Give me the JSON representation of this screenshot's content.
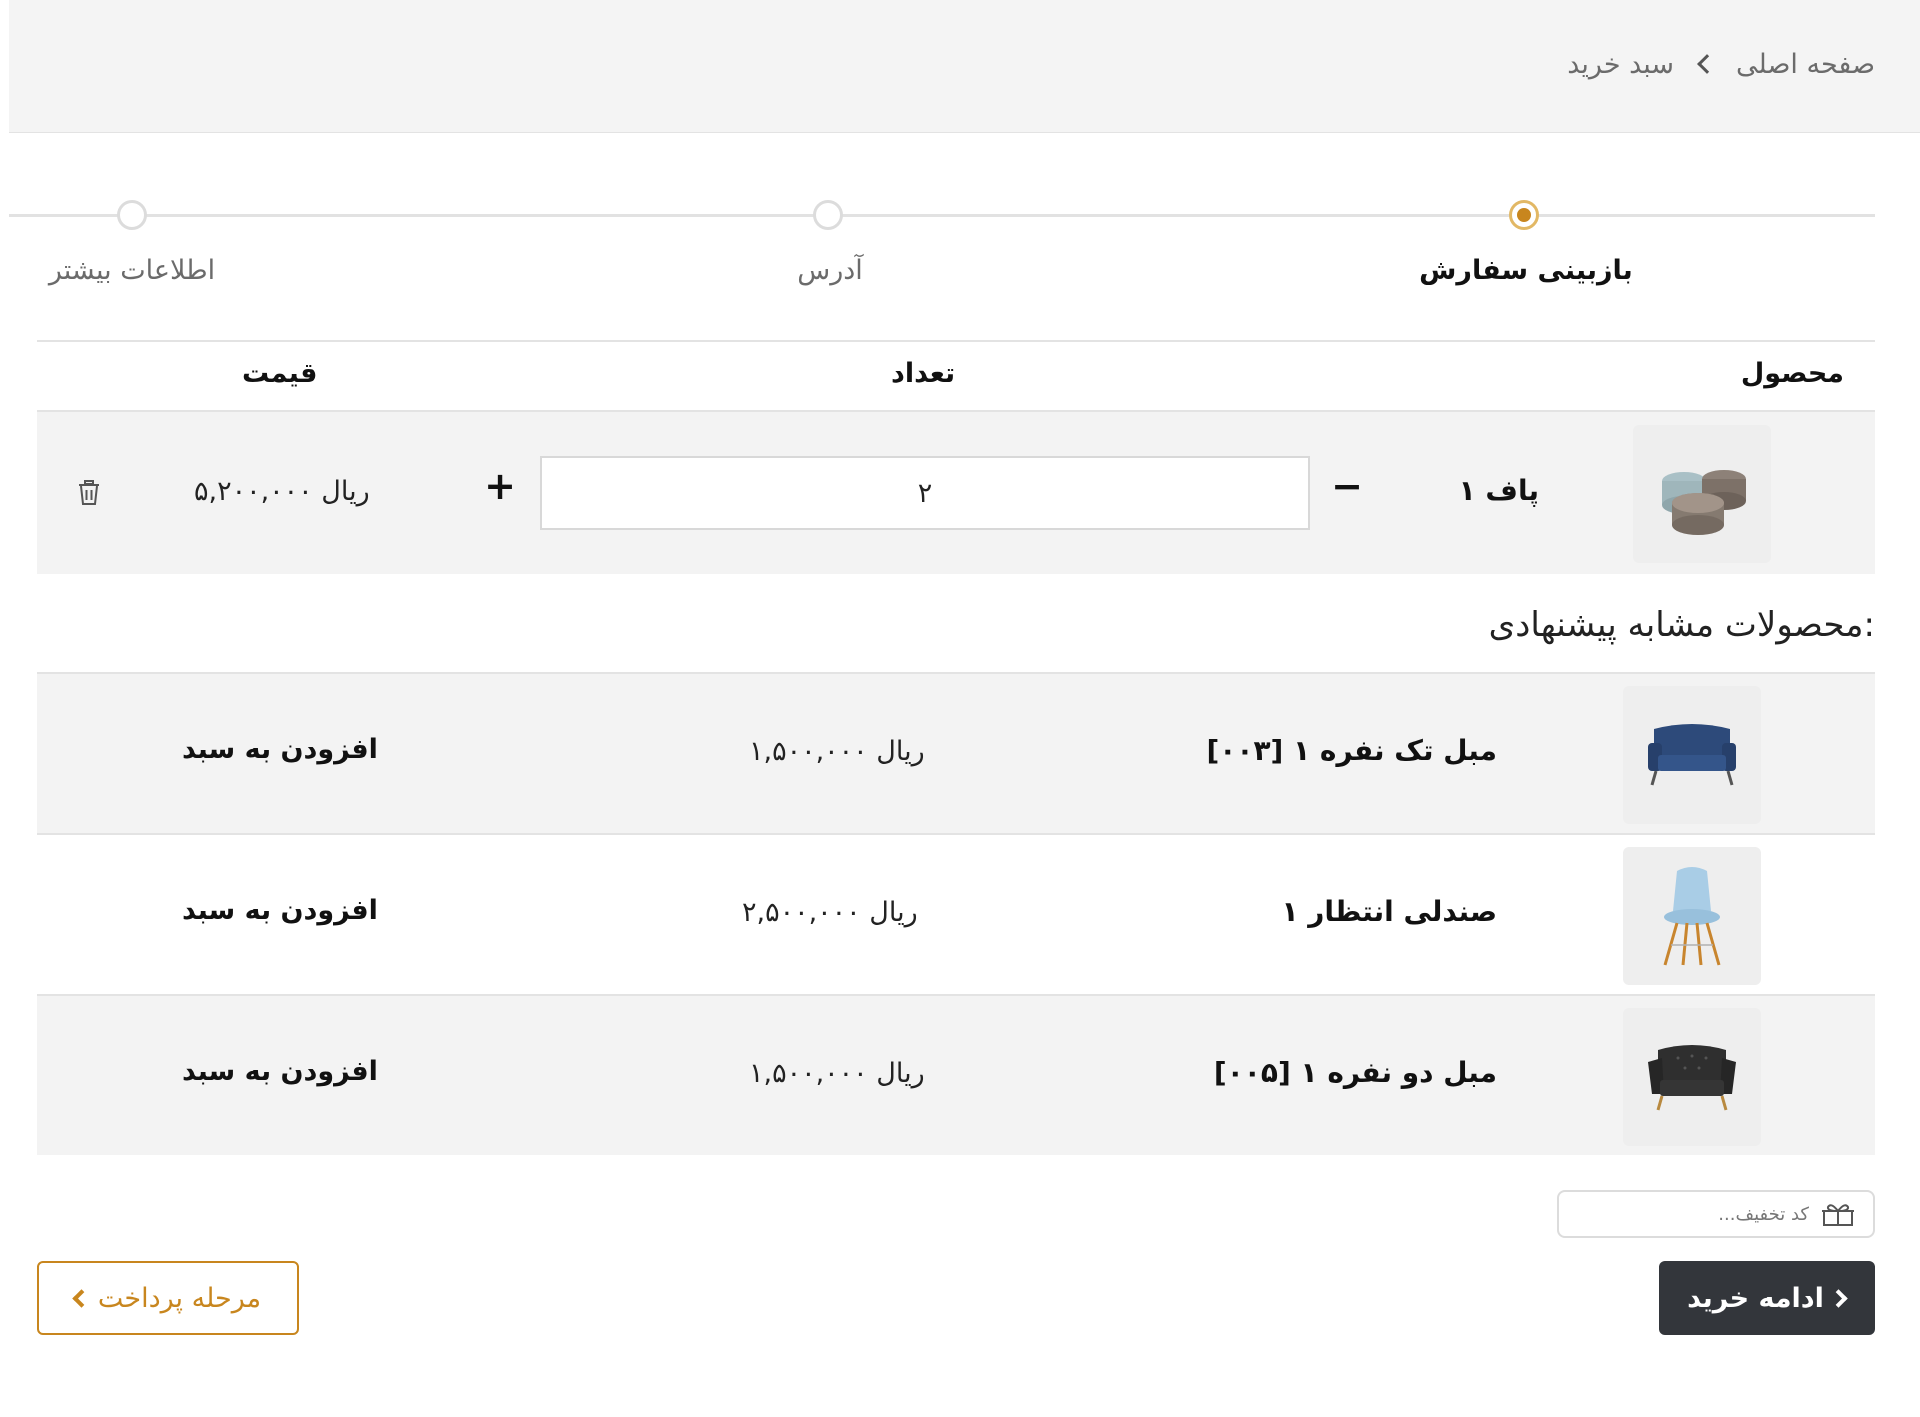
{
  "breadcrumb": {
    "home": "صفحه اصلی",
    "current": "سبد خرید"
  },
  "steps": [
    {
      "label": "بازبینی سفارش",
      "active": true
    },
    {
      "label": "آدرس",
      "active": false
    },
    {
      "label": "اطلاعات بیشتر",
      "active": false
    }
  ],
  "cart": {
    "headers": {
      "product": "محصول",
      "quantity": "تعداد",
      "price": "قیمت"
    },
    "item": {
      "name": "پاف ۱",
      "quantity": "۲",
      "price": "۵,۲۰۰,۰۰۰ ریال",
      "minus": "−",
      "plus": "+"
    }
  },
  "suggestions": {
    "title": "محصولات مشابه پیشنهادی:",
    "add_label": "افزودن به سبد",
    "items": [
      {
        "name": "[۰۰۳] مبل تک نفره ۱",
        "price": "۱,۵۰۰,۰۰۰ ریال"
      },
      {
        "name": "صندلی انتظار ۱",
        "price": "۲,۵۰۰,۰۰۰ ریال"
      },
      {
        "name": "[۰۰۵] مبل دو نفره ۱",
        "price": "۱,۵۰۰,۰۰۰ ریال"
      }
    ]
  },
  "coupon": {
    "text": "...کد تخفیف"
  },
  "buttons": {
    "continue": "ادامه خرید",
    "pay": "مرحله پرداخت"
  },
  "colors": {
    "accent": "#c8861e",
    "dark_button": "#33363b",
    "row_shade": "#f3f3f3"
  }
}
